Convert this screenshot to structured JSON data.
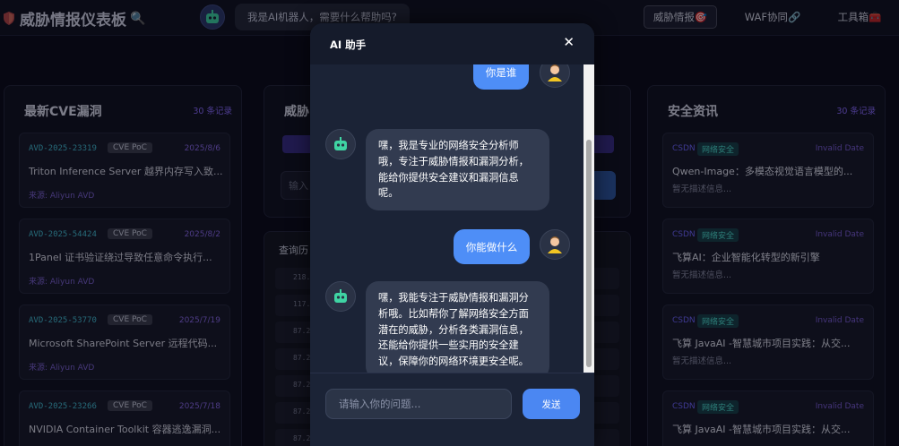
{
  "header": {
    "title": "威胁情报仪表板",
    "shield_icon": "shield-icon",
    "search_icon": "magnifier-icon",
    "bot_greeting": "我是AI机器人，需要什么帮助吗?",
    "nav": [
      {
        "label": "威胁情报🎯",
        "active": true
      },
      {
        "label": "WAF协同🔗",
        "active": false
      },
      {
        "label": "工具箱🧰",
        "active": false
      }
    ]
  },
  "left_panel": {
    "title": "最新CVE漏洞",
    "count": "30 条记录",
    "cards": [
      {
        "id": "AVD-2025-23319",
        "badge": "CVE PoC",
        "date": "2025/8/6",
        "title": "Triton Inference Server 越界内存写入致...",
        "source": "来源: Aliyun AVD"
      },
      {
        "id": "AVD-2025-54424",
        "badge": "CVE PoC",
        "date": "2025/8/2",
        "title": "1Panel 证书验证绕过导致任意命令执行...",
        "source": "来源: Aliyun AVD"
      },
      {
        "id": "AVD-2025-53770",
        "badge": "CVE PoC",
        "date": "2025/7/19",
        "title": "Microsoft SharePoint Server 远程代码...",
        "source": "来源: Aliyun AVD"
      },
      {
        "id": "AVD-2025-23266",
        "badge": "CVE PoC",
        "date": "2025/7/18",
        "title": "NVIDIA Container Toolkit 容器逃逸漏洞...",
        "source": ""
      }
    ]
  },
  "middle_panel": {
    "title": "威胁",
    "input_placeholder": "输入",
    "history_label": "查询历",
    "history_rows": [
      "218.",
      "117.",
      "87.2",
      "87.2",
      "87.2",
      "87.2",
      "87.2"
    ]
  },
  "right_panel": {
    "title": "安全资讯",
    "count": "30 条记录",
    "cards": [
      {
        "source": "CSDN",
        "tag": "网络安全",
        "date": "Invalid Date",
        "title": "Qwen-Image：多模态视觉语言模型的...",
        "desc": "暂无描述信息..."
      },
      {
        "source": "CSDN",
        "tag": "网络安全",
        "date": "Invalid Date",
        "title": "飞算AI：企业智能化转型的新引擎",
        "desc": "暂无描述信息..."
      },
      {
        "source": "CSDN",
        "tag": "网络安全",
        "date": "Invalid Date",
        "title": "飞算 JavaAI -智慧城市项目实践：从交...",
        "desc": "暂无描述信息..."
      },
      {
        "source": "CSDN",
        "tag": "网络安全",
        "date": "Invalid Date",
        "title": "飞算 JavaAI -智慧城市项目实践：从交...",
        "desc": ""
      }
    ]
  },
  "chat": {
    "title": "AI 助手",
    "close_label": "✕",
    "messages": [
      {
        "role": "user",
        "text": "你是谁"
      },
      {
        "role": "bot",
        "lines": [
          "嘿，我是专业的网络安全分析师",
          "哦，专注于威胁情报和漏洞分析，",
          "能给你提供安全建议和漏洞信息",
          "呢。"
        ]
      },
      {
        "role": "user",
        "text": "你能做什么"
      },
      {
        "role": "bot",
        "lines": [
          "嘿，我能专注于威胁情报和漏洞分",
          "析哦。比如帮你了解网络安全方面",
          "潜在的威胁，分析各类漏洞信息，",
          "还能给你提供一些实用的安全建",
          "议，保障你的网络环境更安全呢。"
        ]
      }
    ],
    "input_placeholder": "请输入你的问题...",
    "send_label": "发送"
  }
}
